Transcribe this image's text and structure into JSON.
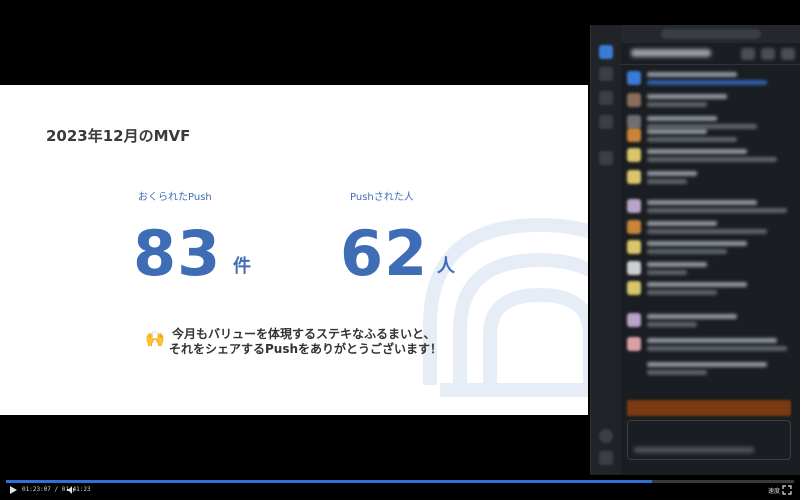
{
  "slide": {
    "title": "2023年12月のMVF",
    "stats": [
      {
        "label": "おくられたPush",
        "value": "83",
        "unit": "件"
      },
      {
        "label": "Pushされた人",
        "value": "62",
        "unit": "人"
      }
    ],
    "message_emoji": "🙌",
    "message_lines": [
      "今月もバリューを体現するステキなふるまいと、",
      "それをシェアするPushをありがとうございます！"
    ]
  },
  "player": {
    "time_text": "01:23:07 / 01:41:23",
    "progress_fraction": 0.82,
    "speed_label": "速度"
  },
  "colors": {
    "accent": "#3e6db5",
    "deco": "#e6edf6",
    "progress": "#2f6fd6",
    "chat_bg": "#1a1d21"
  }
}
